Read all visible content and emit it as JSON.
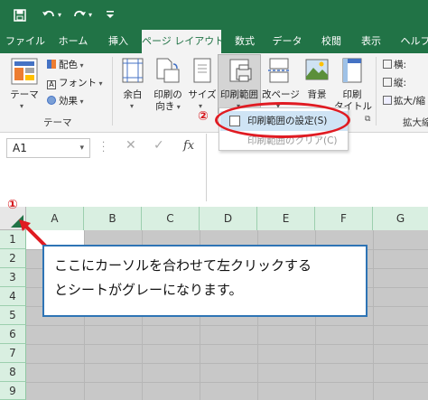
{
  "qat": {
    "save_icon": "save-icon",
    "undo_icon": "undo-icon",
    "redo_icon": "redo-icon",
    "customize_icon": "customize-qat-icon"
  },
  "tabs": [
    {
      "label": "ファイル"
    },
    {
      "label": "ホーム"
    },
    {
      "label": "挿入"
    },
    {
      "label": "ページ レイアウト",
      "active": true
    },
    {
      "label": "数式"
    },
    {
      "label": "データ"
    },
    {
      "label": "校閲"
    },
    {
      "label": "表示"
    },
    {
      "label": "ヘルプ"
    }
  ],
  "ribbon": {
    "theme": {
      "theme_label": "テーマ",
      "colors_label": "配色",
      "fonts_label": "フォント",
      "effects_label": "効果",
      "group_label": "テーマ"
    },
    "page_setup": {
      "margins_label": "余白",
      "orientation_label_1": "印刷の",
      "orientation_label_2": "向き",
      "size_label": "サイズ",
      "print_area_label": "印刷範囲",
      "breaks_label": "改ページ",
      "background_label": "背景",
      "print_titles_label_1": "印刷",
      "print_titles_label_2": "タイトル"
    },
    "scale": {
      "width_label": "横:",
      "height_label": "縦:",
      "scale_label": "拡大/縮",
      "group_label": "拡大縮"
    }
  },
  "dropdown": {
    "items": [
      {
        "label": "印刷範囲の設定(S)"
      },
      {
        "label": "印刷範囲のクリア(C)"
      }
    ]
  },
  "markers": {
    "one": "①",
    "two": "②"
  },
  "formula_bar": {
    "name_box": "A1",
    "cancel_symbol": "✕",
    "enter_symbol": "✓",
    "fx_symbol": "fx"
  },
  "grid": {
    "columns": [
      "A",
      "B",
      "C",
      "D",
      "E",
      "F",
      "G"
    ],
    "rows": [
      "1",
      "2",
      "3",
      "4",
      "5",
      "6",
      "7",
      "8",
      "9"
    ]
  },
  "callout": {
    "line1": "ここにカーソルを合わせて左クリックする",
    "line2": "とシートがグレーになります。"
  },
  "colors": {
    "excel_green": "#217346",
    "highlight_red": "#e01b22",
    "callout_border": "#2e74b5"
  }
}
